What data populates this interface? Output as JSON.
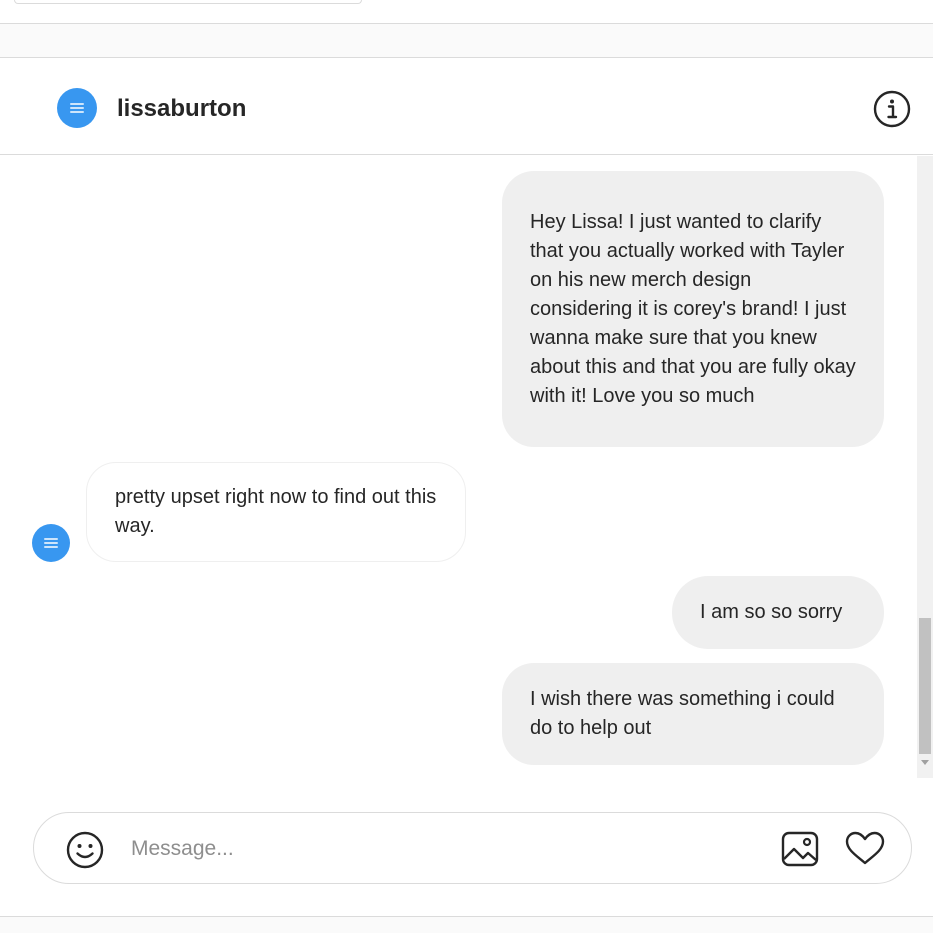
{
  "header": {
    "username": "lissaburton"
  },
  "thread": {
    "messages": [
      {
        "direction": "outgoing",
        "text": "Hey Lissa! I just wanted to clarify that you actually worked with Tayler on his new merch design considering it is corey's brand! I just wanna make sure that you knew about this and that you are fully okay with it! Love you so much"
      },
      {
        "direction": "incoming",
        "text": "pretty upset right now to find out this way."
      },
      {
        "direction": "outgoing",
        "text": "I am so so sorry"
      },
      {
        "direction": "outgoing",
        "text": "I wish there was something i could do to help out"
      }
    ]
  },
  "composer": {
    "placeholder": "Message...",
    "value": ""
  },
  "icons": {
    "info": "info-icon",
    "emoji": "emoji-icon",
    "image": "image-icon",
    "heart": "heart-icon"
  },
  "colors": {
    "avatar": "#3897f0",
    "outgoing_bubble": "#efefef",
    "border": "#dbdbdb"
  }
}
